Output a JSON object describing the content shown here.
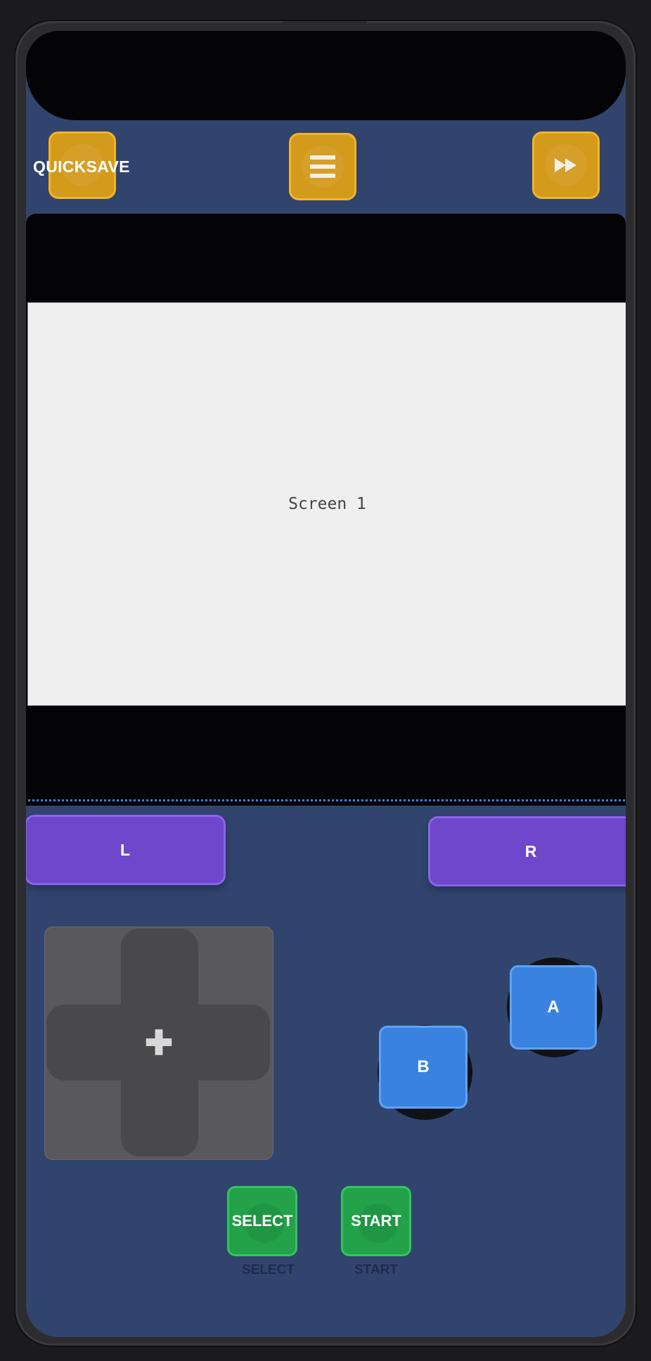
{
  "toolbar": {
    "quicksave_label": "QUICKSAVE",
    "menu_icon": "hamburger-menu-icon",
    "fastforward_icon": "fast-forward-icon"
  },
  "display": {
    "screen1_label": "Screen 1"
  },
  "controls": {
    "l_label": "L",
    "r_label": "R",
    "dpad_icon": "plus-icon",
    "a_label": "A",
    "b_label": "B",
    "select_label": "SELECT",
    "start_label": "START",
    "select_caption": "SELECT",
    "start_caption": "START"
  },
  "colors": {
    "body_bg": "#31446e",
    "menu_button": "#d39a1c",
    "shoulder_button": "#6e47cc",
    "face_button": "#3a82e0",
    "system_button": "#23a24a",
    "divider": "#3e7fe6"
  }
}
